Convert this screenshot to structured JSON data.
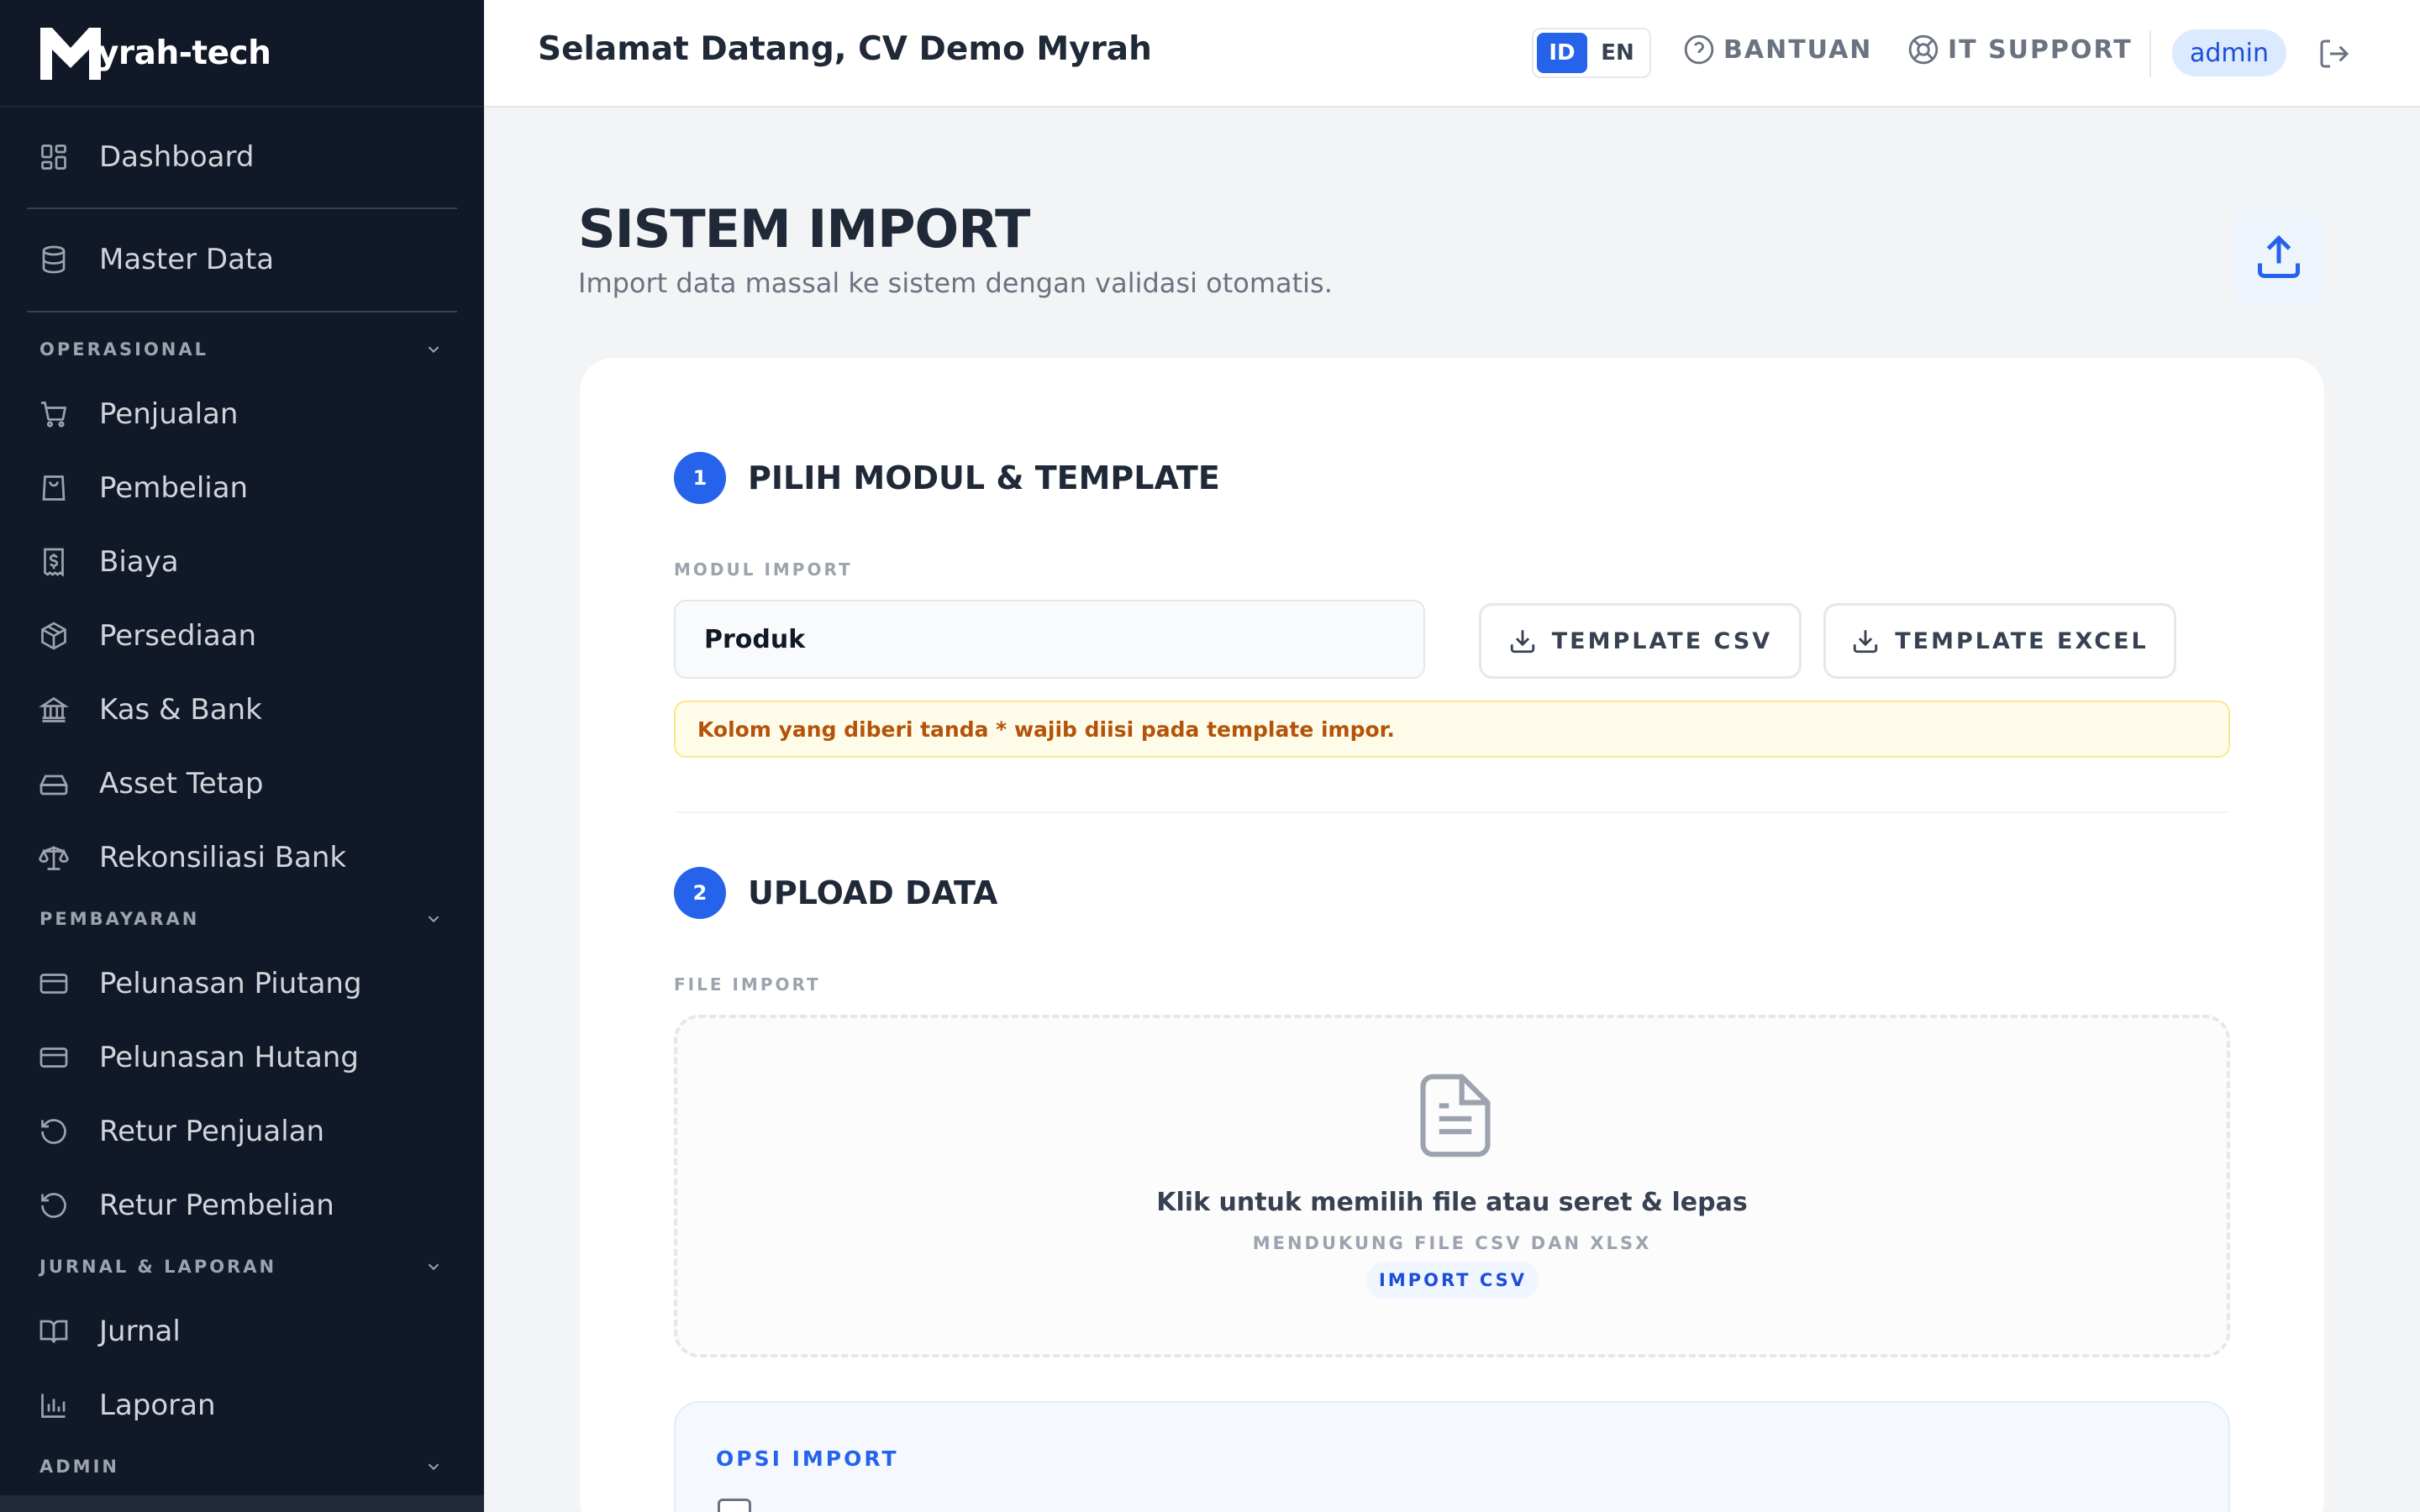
{
  "app": {
    "logo_text": "yrah-tech",
    "logo_mark": "M"
  },
  "sidebar": {
    "top_items": [
      {
        "label": "Dashboard",
        "icon": "dashboard-icon"
      },
      {
        "label": "Master Data",
        "icon": "database-icon"
      }
    ],
    "groups": [
      {
        "label": "OPERASIONAL",
        "items": [
          {
            "label": "Penjualan",
            "icon": "cart-icon"
          },
          {
            "label": "Pembelian",
            "icon": "shopping-bag-icon"
          },
          {
            "label": "Biaya",
            "icon": "receipt-dollar-icon"
          },
          {
            "label": "Persediaan",
            "icon": "box-icon"
          },
          {
            "label": "Kas & Bank",
            "icon": "bank-icon"
          },
          {
            "label": "Asset Tetap",
            "icon": "hard-drive-icon"
          },
          {
            "label": "Rekonsiliasi Bank",
            "icon": "scale-icon"
          }
        ]
      },
      {
        "label": "PEMBAYARAN",
        "items": [
          {
            "label": "Pelunasan Piutang",
            "icon": "credit-card-icon"
          },
          {
            "label": "Pelunasan Hutang",
            "icon": "credit-card-icon"
          },
          {
            "label": "Retur Penjualan",
            "icon": "rotate-ccw-icon"
          },
          {
            "label": "Retur Pembelian",
            "icon": "rotate-ccw-icon"
          }
        ]
      },
      {
        "label": "JURNAL & LAPORAN",
        "items": [
          {
            "label": "Jurnal",
            "icon": "book-open-icon"
          },
          {
            "label": "Laporan",
            "icon": "bar-chart-icon"
          }
        ]
      },
      {
        "label": "ADMIN",
        "items": []
      }
    ]
  },
  "header": {
    "welcome": "Selamat Datang, CV Demo Myrah",
    "lang_id": "ID",
    "lang_en": "EN",
    "lang_active": "ID",
    "help_label": "BANTUAN",
    "support_label": "IT SUPPORT",
    "user": "admin"
  },
  "page": {
    "title": "SISTEM IMPORT",
    "subtitle": "Import data massal ke sistem dengan validasi otomatis."
  },
  "step1": {
    "number": "1",
    "title": "PILIH MODUL & TEMPLATE",
    "field_label": "MODUL IMPORT",
    "selected_module": "Produk",
    "template_csv_label": "TEMPLATE CSV",
    "template_excel_label": "TEMPLATE EXCEL",
    "notice": "Kolom yang diberi tanda * wajib diisi pada template impor."
  },
  "step2": {
    "number": "2",
    "title": "UPLOAD DATA",
    "field_label": "FILE IMPORT",
    "dropzone_title": "Klik untuk memilih file atau seret & lepas",
    "dropzone_sub": "MENDUKUNG FILE CSV DAN XLSX",
    "dropzone_badge": "IMPORT CSV"
  },
  "options": {
    "title": "OPSI IMPORT"
  },
  "colors": {
    "sidebar_bg": "#111827",
    "accent": "#2563eb",
    "notice_text": "#b45309",
    "page_bg": "#f3f4f6"
  }
}
